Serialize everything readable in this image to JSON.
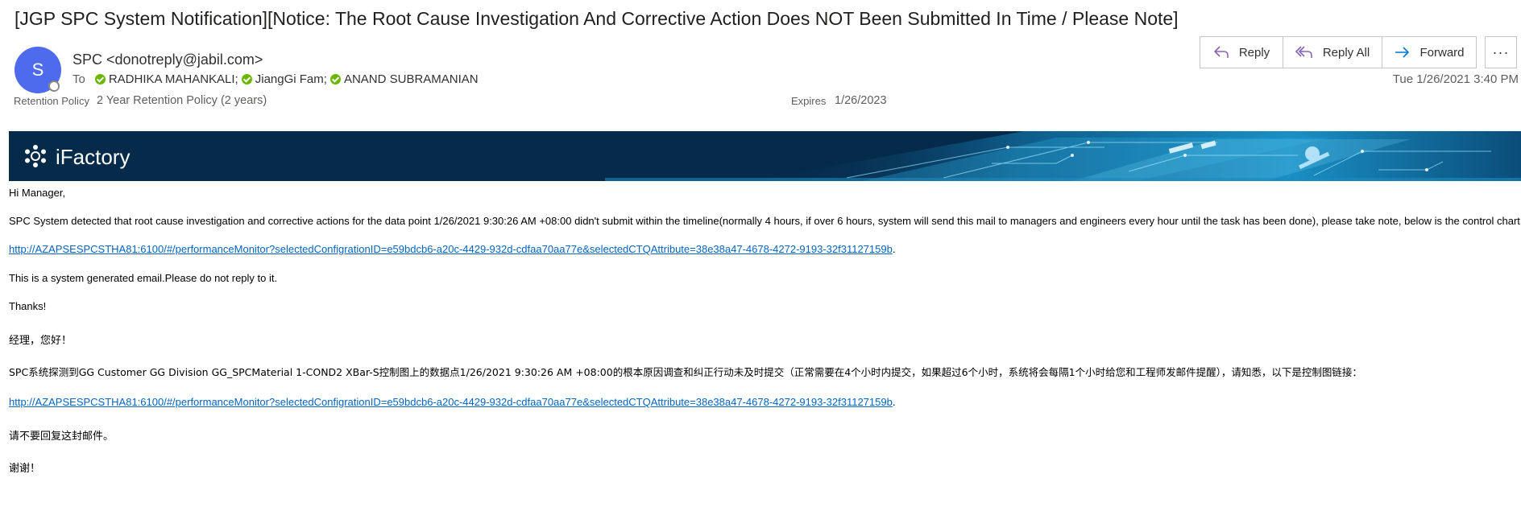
{
  "subject": "[JGP SPC System Notification][Notice: The Root Cause Investigation And Corrective Action Does NOT Been Submitted In Time / Please Note]",
  "sender": {
    "initial": "S",
    "display": "SPC <donotreply@jabil.com>",
    "avatar_color": "#4f6bed"
  },
  "to": {
    "label": "To",
    "recipients": [
      "RADHIKA MAHANKALI;",
      "JiangGi Fam;",
      "ANAND SUBRAMANIAN"
    ]
  },
  "retention": {
    "label": "Retention Policy",
    "value": "2 Year Retention Policy (2 years)",
    "expires_label": "Expires",
    "expires_value": "1/26/2023"
  },
  "actions": {
    "reply": "Reply",
    "reply_all": "Reply All",
    "forward": "Forward",
    "more": "···"
  },
  "datetime": "Tue 1/26/2021 3:40 PM",
  "banner": {
    "title": "iFactory",
    "bg_color": "#062a4a"
  },
  "body": {
    "greeting": "Hi Manager,",
    "para1": "SPC System detected that root cause investigation and corrective actions for the data point 1/26/2021 9:30:26 AM +08:00 didn't submit within the timeline(normally 4 hours, if over 6 hours, system will send this mail to managers and engineers every hour until the task has been done), please take note, below is the control chart link:",
    "link1": "http://AZAPSESPCSTHA81:6100/#/performanceMonitor?selectedConfigrationID=e59bdcb6-a20c-4429-932d-cdfaa70aa77e&selectedCTQAttribute=38e38a47-4678-4272-9193-32f31127159b",
    "period": ".",
    "noreply": "This is a system generated email.Please do not reply to it.",
    "thanks": "Thanks!",
    "greeting_cn": "经理，您好！",
    "para_cn": "SPC系统探测到GG Customer GG Division GG_SPCMaterial 1-COND2 XBar-S控制图上的数据点1/26/2021 9:30:26 AM +08:00的根本原因调查和纠正行动未及时提交（正常需要在4个小时内提交，如果超过6个小时，系统将会每隔1个小时给您和工程师发邮件提醒），请知悉，以下是控制图链接：",
    "link2": "http://AZAPSESPCSTHA81:6100/#/performanceMonitor?selectedConfigrationID=e59bdcb6-a20c-4429-932d-cdfaa70aa77e&selectedCTQAttribute=38e38a47-4678-4272-9193-32f31127159b",
    "noreply_cn": "请不要回复这封邮件。",
    "thanks_cn": "谢谢！",
    "link_color": "#0563c1"
  }
}
